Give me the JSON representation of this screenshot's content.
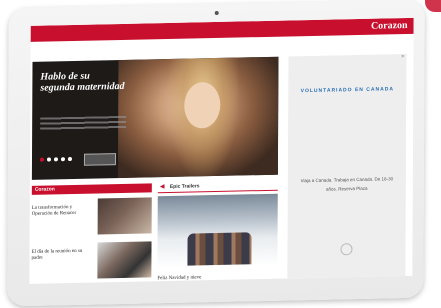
{
  "brand": {
    "name": "Corazon"
  },
  "hero": {
    "title": "Hablo de su segunda maternidad"
  },
  "sidebar": {
    "close_label": "×",
    "title": "VOLUNTARIADO EN CANADA",
    "text": "Viaja a Canada. Trabaja en Canada. De 18-30 años. Reserva Plaza"
  },
  "left_section": {
    "header": "Corazon",
    "articles": [
      {
        "title": "La transformación y Operación de Renacer"
      },
      {
        "title": "El día de la reunión en su padre"
      }
    ]
  },
  "mid_section": {
    "header": "Epic Trailers",
    "title": "Feliz Navidad y nieve"
  },
  "colors": {
    "accent": "#c8102e",
    "sidebar_title": "#2a6fb6"
  }
}
